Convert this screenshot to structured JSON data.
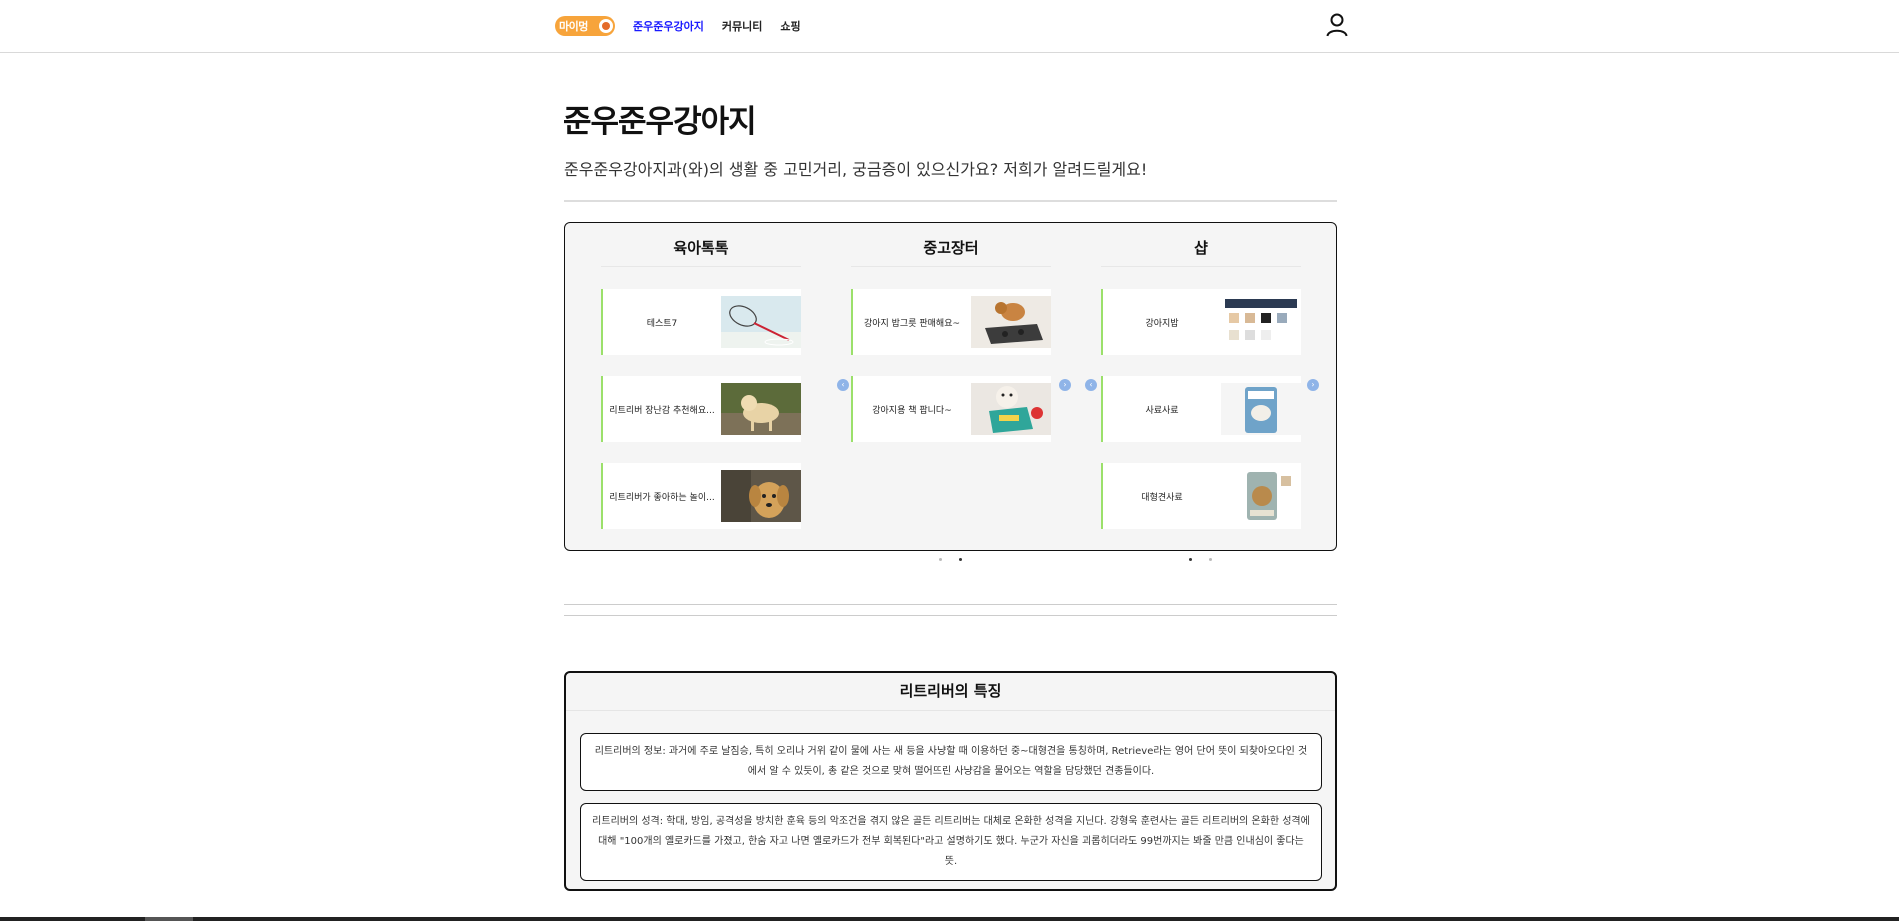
{
  "header": {
    "logo_text": "마이멍",
    "nav": [
      "준우준우강아지",
      "커뮤니티",
      "쇼핑"
    ]
  },
  "page": {
    "title": "준우준우강아지",
    "subtitle": "준우준우강아지과(와)의 생활 중 고민거리, 궁금증이 있으신가요? 저희가 알려드릴게요!"
  },
  "boards": [
    {
      "title": "육아톡톡",
      "items": [
        "테스트7",
        "리트리버 장난감 추천해요...",
        "리트리버가 좋아하는 놀이..."
      ]
    },
    {
      "title": "중고장터",
      "items": [
        "강아지 밥그릇 판매해요~",
        "강아지용 책 팝니다~"
      ]
    },
    {
      "title": "샵",
      "items": [
        "강아지밥",
        "사료사료",
        "대형견사료"
      ]
    }
  ],
  "features": {
    "title": "리트리버의 특징",
    "info": "리트리버의 정보: 과거에 주로 날짐승, 특히 오리나 거위 같이 물에 사는 새 등을 사냥할 때 이용하던 중~대형견을 통칭하며, Retrieve라는 영어 단어 뜻이 되찾아오다인 것에서 알 수 있듯이, 총 같은 것으로 맞혀 떨어뜨린 사냥감을 물어오는 역할을 담당했던 견종들이다.",
    "personality": "리트리버의 성격: 학대, 방임, 공격성을 방치한 훈육 등의 악조건을 겪지 않은 골든 리트리버는 대체로 온화한 성격을 지닌다. 강형욱 훈련사는 골든 리트리버의 온화한 성격에 대해 \"100개의 옐로카드를 가졌고, 한숨 자고 나면 옐로카드가 전부 회복된다\"라고 설명하기도 했다. 누군가 자신을 괴롭히더라도 99번까지는 봐줄 만큼 인내심이 좋다는 뜻."
  }
}
